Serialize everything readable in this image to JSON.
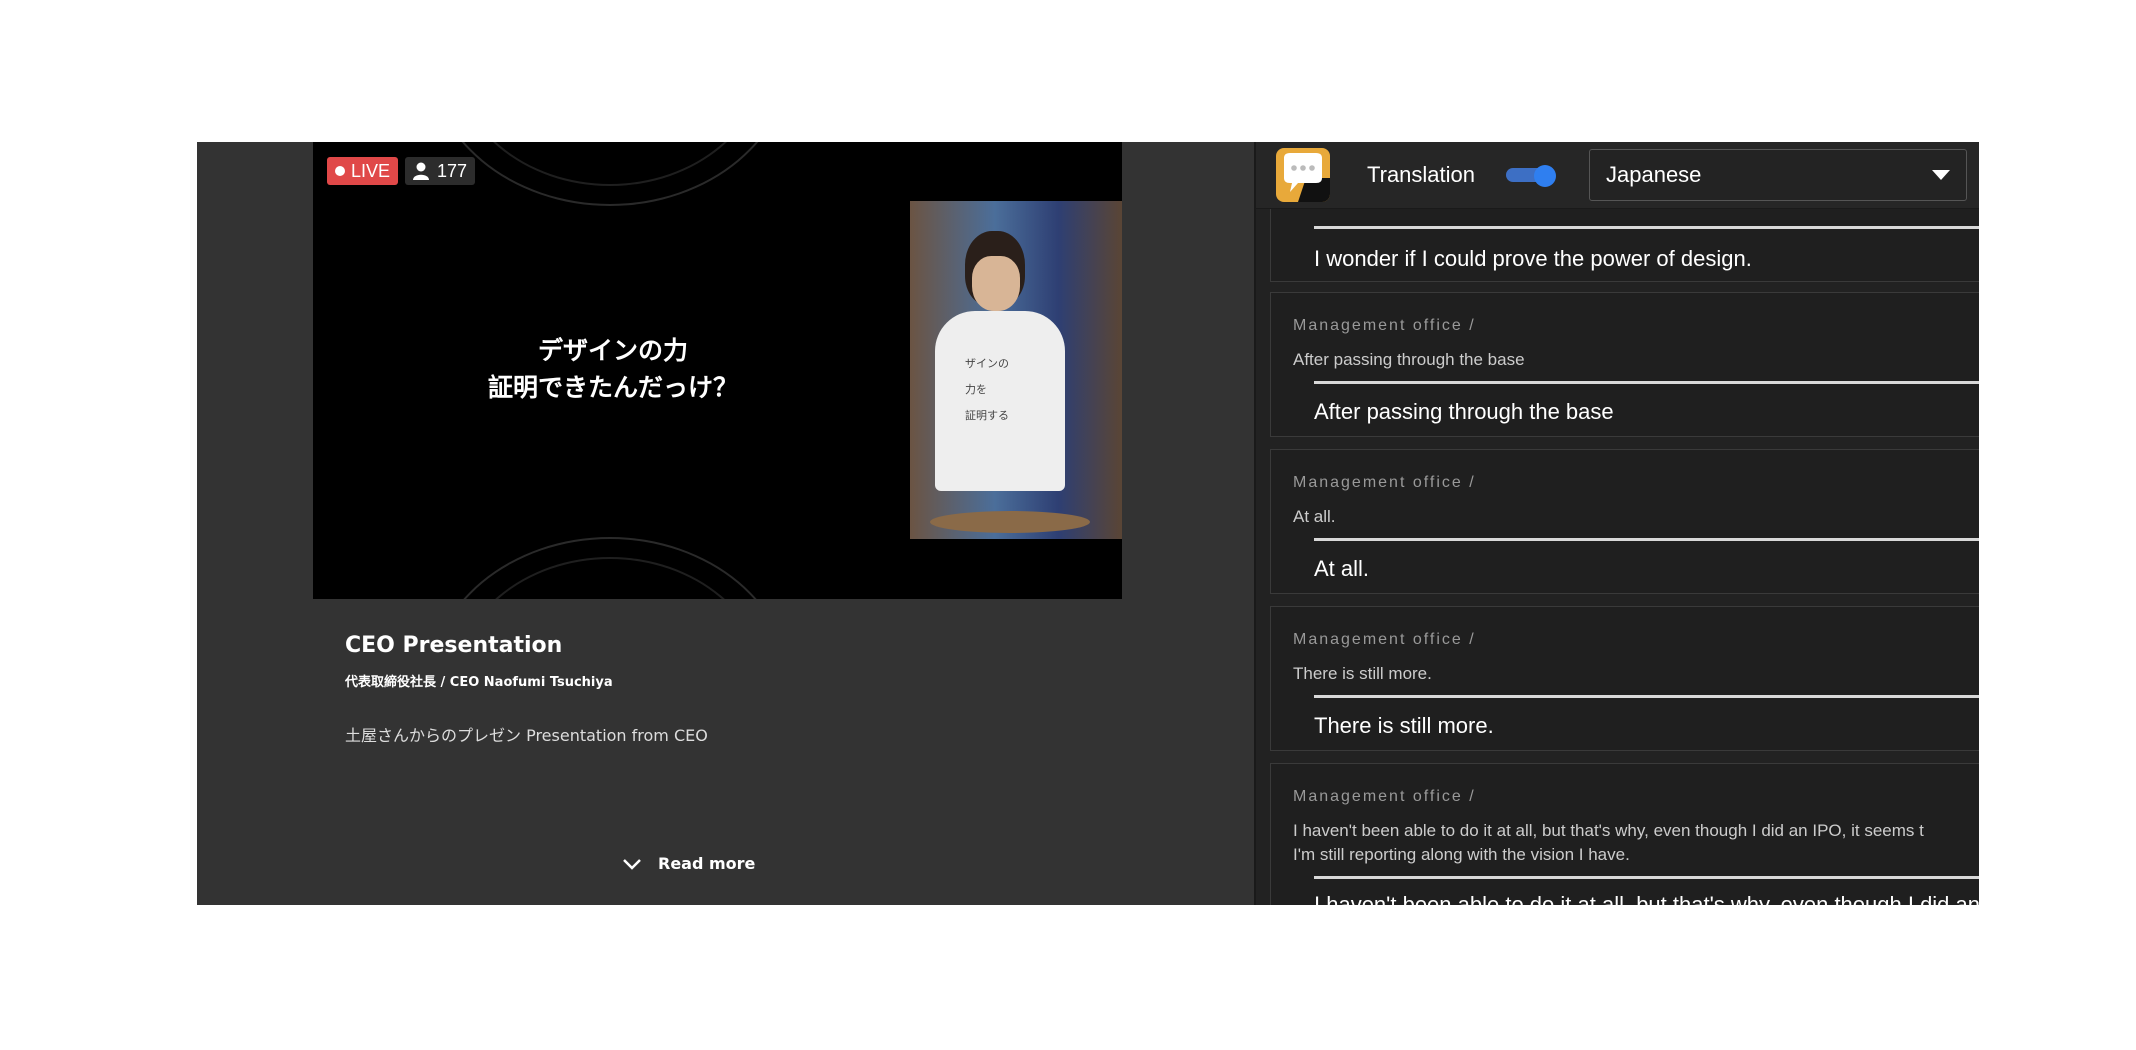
{
  "video": {
    "live_label": "LIVE",
    "viewer_count": "177",
    "slide_line1": "デザインの力",
    "slide_line2": "証明できたんだっけ？",
    "shirt_line1": "ザインの",
    "shirt_line2": "力を",
    "shirt_line3": "証明する"
  },
  "info": {
    "title": "CEO Presentation",
    "subtitle": "代表取締役社長 / CEO  Naofumi Tsuchiya",
    "description": "土屋さんからのプレゼン Presentation from CEO",
    "read_more": "Read more"
  },
  "panel": {
    "translation_label": "Translation",
    "toggle_on": true,
    "language": "Japanese",
    "entries": [
      {
        "speaker": "",
        "original": "",
        "translated": "I wonder if I could prove the power of design."
      },
      {
        "speaker": "Management office /",
        "original": "After passing through the base",
        "translated": "After passing through the base"
      },
      {
        "speaker": "Management office /",
        "original": "At all.",
        "translated": "At all."
      },
      {
        "speaker": "Management office /",
        "original": "There is still more.",
        "translated": "There is still more."
      },
      {
        "speaker": "Management office /",
        "original": "I haven't been able to do it at all, but that's why, even though I did an IPO, it seems t",
        "original2": "I'm still reporting along with the vision I have.",
        "translated": "I haven't been able to do it at all, but that's why, even though I did an"
      }
    ]
  },
  "colors": {
    "live_red": "#e04848",
    "toggle_blue": "#2f7ff0",
    "logo_orange": "#e8a93a"
  }
}
